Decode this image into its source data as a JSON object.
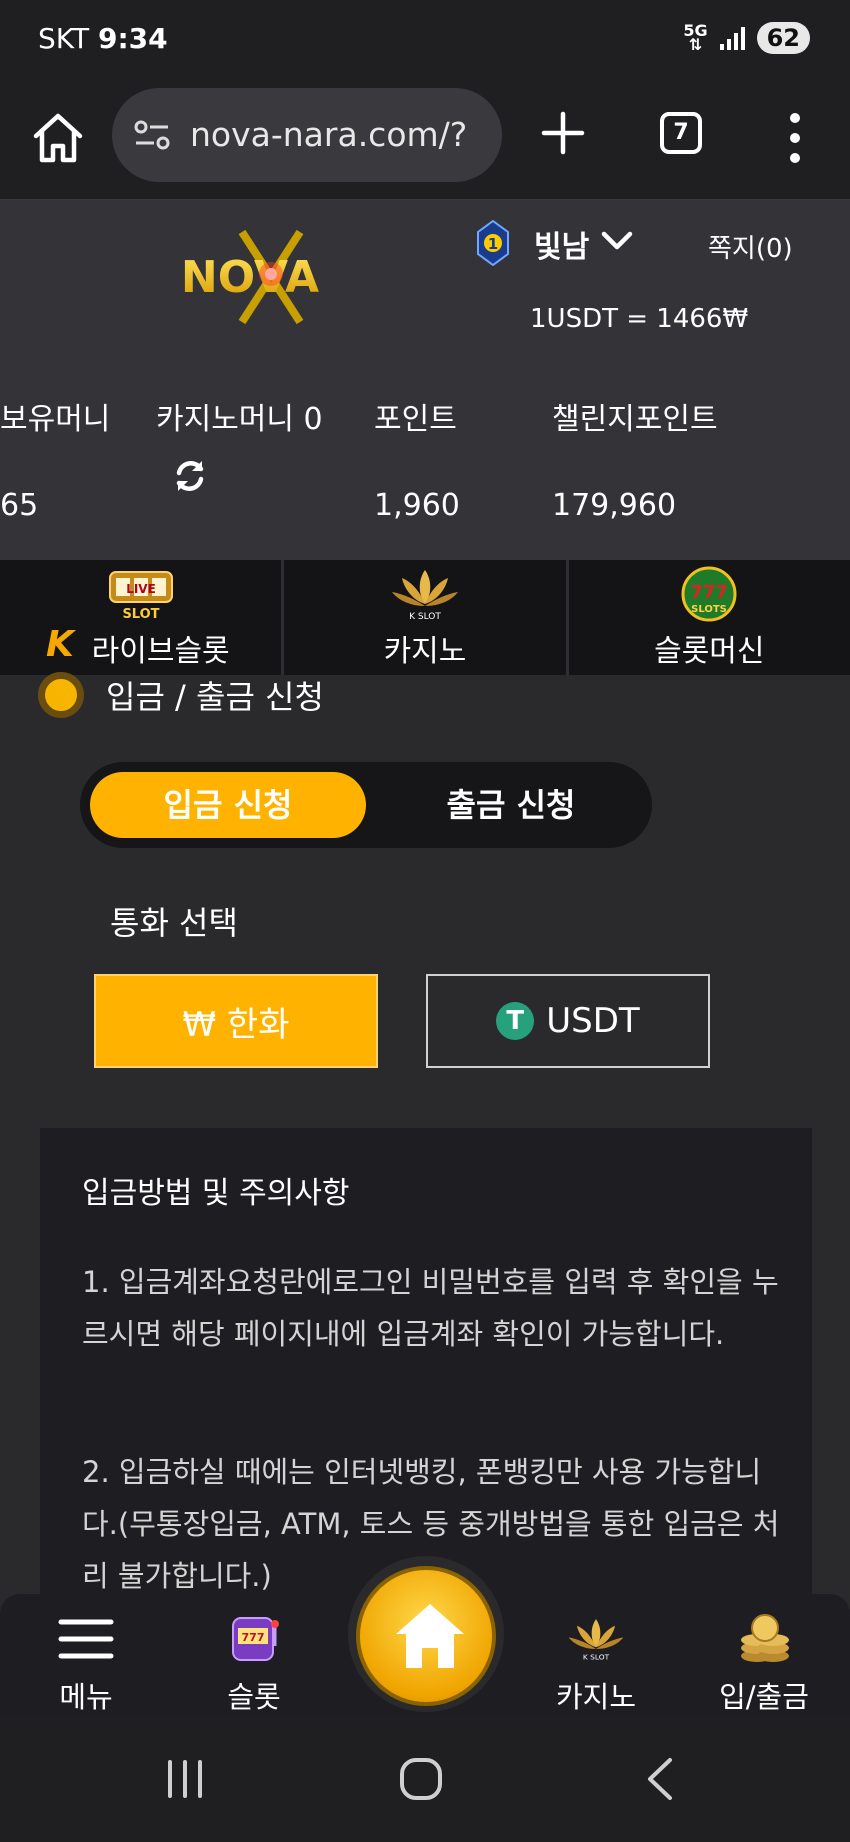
{
  "status_bar": {
    "carrier": "SKT",
    "time": "9:34",
    "network": "5G",
    "battery": "62"
  },
  "browser": {
    "url": "nova-nara.com/?",
    "tab_count": "7"
  },
  "header": {
    "logo_text": "NOVA",
    "level": "1",
    "username": "빛남",
    "messages": "쪽지(0)",
    "exchange_rate": "1USDT = 1466₩"
  },
  "balances": {
    "holding_label": "보유머니",
    "holding_value": "65",
    "casino_label": "카지노머니 0",
    "points_label": "포인트",
    "points_value": "1,960",
    "challenge_label": "챌린지포인트",
    "challenge_value": "179,960"
  },
  "game_nav": [
    {
      "label": "라이브슬롯",
      "icon": "live-slot-icon",
      "badge": "K"
    },
    {
      "label": "카지노",
      "icon": "k-slot-lotus-icon"
    },
    {
      "label": "슬롯머신",
      "icon": "777-slots-icon"
    }
  ],
  "section_title": "입금 / 출금 신청",
  "toggle": {
    "deposit": "입금 신청",
    "withdraw": "출금 신청"
  },
  "currency": {
    "label": "통화 선택",
    "krw": "₩ 한화",
    "usdt": "USDT",
    "usdt_icon": "T"
  },
  "notice": {
    "title": "입금방법 및 주의사항",
    "p1": "1. 입금계좌요청란에로그인 비밀번호를 입력 후 확인을 누르시면 해당 페이지내에 입금계좌 확인이 가능합니다.",
    "p2": "2. 입금하실 때에는 인터넷뱅킹, 폰뱅킹만 사용 가능합니다.(무통장입금, ATM, 토스 등 중개방법을 통한 입금은 처리 불가합니다.)"
  },
  "bottom_nav": {
    "menu": "메뉴",
    "slot": "슬롯",
    "casino": "카지노",
    "cash": "입/출금"
  },
  "colors": {
    "accent": "#ffb300",
    "background": "#2a2a2d",
    "header_bg": "#333338",
    "tether": "#26a17b"
  }
}
